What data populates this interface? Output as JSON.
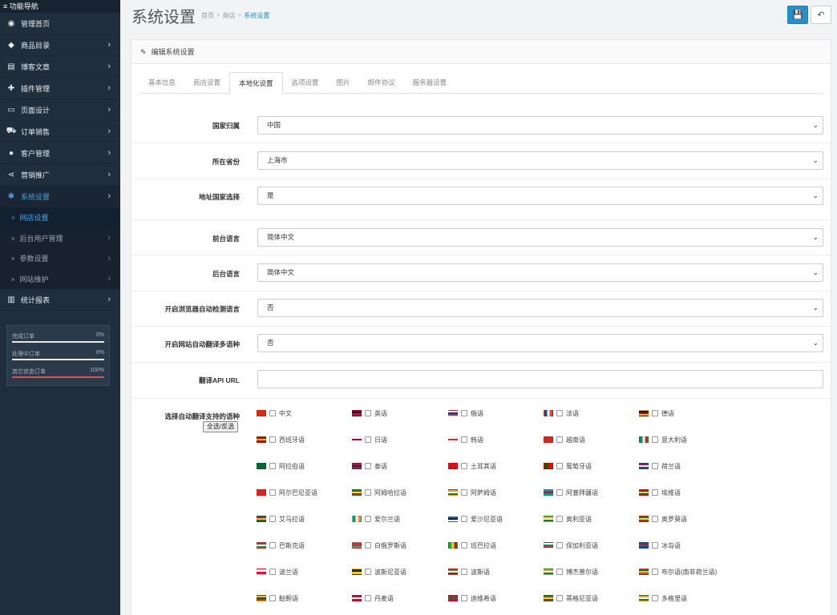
{
  "sidebar": {
    "title": "≡ 功能导航",
    "items": [
      {
        "label": "管理首页",
        "icon": "dashboard-icon",
        "glyph": "◉",
        "chevron": false
      },
      {
        "label": "商品目录",
        "icon": "tag-icon",
        "glyph": "◆",
        "chevron": true
      },
      {
        "label": "博客文章",
        "icon": "newspaper-icon",
        "glyph": "▤",
        "chevron": true
      },
      {
        "label": "插件管理",
        "icon": "puzzle-icon",
        "glyph": "✚",
        "chevron": true
      },
      {
        "label": "页面设计",
        "icon": "desktop-icon",
        "glyph": "▭",
        "chevron": true
      },
      {
        "label": "订单销售",
        "icon": "cart-icon",
        "glyph": "⛟",
        "chevron": true
      },
      {
        "label": "客户管理",
        "icon": "user-icon",
        "glyph": "●",
        "chevron": true
      },
      {
        "label": "营销推广",
        "icon": "share-icon",
        "glyph": "⋖",
        "chevron": true
      },
      {
        "label": "系统设置",
        "icon": "gear-icon",
        "glyph": "✱",
        "chevron": true
      }
    ],
    "sub_items": [
      {
        "label": "网店设置",
        "chevron": false
      },
      {
        "label": "后台用户管理",
        "chevron": true
      },
      {
        "label": "参数设置",
        "chevron": true
      },
      {
        "label": "网站维护",
        "chevron": true
      }
    ],
    "reports": {
      "label": "统计报表",
      "icon": "bar-chart-icon",
      "glyph": "▥"
    },
    "stats": [
      {
        "label": "完成订单",
        "value": "0%",
        "fraction": 0,
        "color": "#5cb85c"
      },
      {
        "label": "处理中订单",
        "value": "0%",
        "fraction": 0,
        "color": "#f0ad4e"
      },
      {
        "label": "其它状态订单",
        "value": "100%",
        "fraction": 1,
        "color": "#d9534f"
      }
    ]
  },
  "header": {
    "title": "系统设置",
    "breadcrumb": [
      "首页",
      "›",
      "商店",
      "›",
      "系统设置"
    ],
    "save_icon": "save-icon",
    "back_icon": "undo-icon"
  },
  "panel": {
    "title": "编辑系统设置",
    "tabs": [
      "基本信息",
      "商店设置",
      "本地化设置",
      "选项设置",
      "图片",
      "邮件协议",
      "服务器设置"
    ],
    "active_tab": "本地化设置"
  },
  "form": {
    "country_label": "国家归属",
    "country_value": "中国",
    "province_label": "所在省份",
    "province_value": "上海市",
    "address_label": "地址国家选择",
    "address_value": "是",
    "front_lang_label": "前台语言",
    "front_lang_value": "简体中文",
    "admin_lang_label": "后台语言",
    "admin_lang_value": "简体中文",
    "browser_detect_label": "开启浏览器自动检测语言",
    "browser_detect_value": "否",
    "auto_translate_label": "开启网站自动翻译多语种",
    "auto_translate_value": "否",
    "api_url_label": "翻译API URL",
    "api_url_value": "",
    "langs_label": "选择自动翻译支持的语种",
    "select_all_label": "全选/反选"
  },
  "languages": [
    {
      "name": "中文",
      "colors": [
        "#de2910",
        "#de2910"
      ]
    },
    {
      "name": "英语",
      "colors": [
        "#012169",
        "#c8102e"
      ]
    },
    {
      "name": "俄语",
      "colors": [
        "#ffffff",
        "#0039a6",
        "#d52b1e"
      ]
    },
    {
      "name": "法语",
      "colors": [
        "#0055a4",
        "#ffffff",
        "#ef4135"
      ],
      "vertical": true
    },
    {
      "name": "德语",
      "colors": [
        "#000000",
        "#dd0000",
        "#ffce00"
      ]
    },
    {
      "name": "西班牙语",
      "colors": [
        "#aa151b",
        "#f1bf00",
        "#aa151b"
      ]
    },
    {
      "name": "日语",
      "colors": [
        "#ffffff",
        "#bc002d",
        "#ffffff"
      ]
    },
    {
      "name": "韩语",
      "colors": [
        "#ffffff",
        "#cd2e3a",
        "#ffffff"
      ]
    },
    {
      "name": "越南语",
      "colors": [
        "#da251d",
        "#da251d"
      ]
    },
    {
      "name": "意大利语",
      "colors": [
        "#009246",
        "#ffffff",
        "#ce2b37"
      ],
      "vertical": true
    },
    {
      "name": "阿拉伯语",
      "colors": [
        "#006c35",
        "#006c35"
      ]
    },
    {
      "name": "泰语",
      "colors": [
        "#a51931",
        "#2d2a4a",
        "#a51931"
      ]
    },
    {
      "name": "土耳其语",
      "colors": [
        "#e30a17",
        "#e30a17"
      ]
    },
    {
      "name": "葡萄牙语",
      "colors": [
        "#006600",
        "#ff0000"
      ],
      "vertical": true
    },
    {
      "name": "荷兰语",
      "colors": [
        "#ae1c28",
        "#ffffff",
        "#21468b"
      ]
    },
    {
      "name": "阿尔巴尼亚语",
      "colors": [
        "#e41e20",
        "#e41e20"
      ]
    },
    {
      "name": "阿姆哈拉语",
      "colors": [
        "#078930",
        "#fcdd09",
        "#da121a"
      ]
    },
    {
      "name": "阿萨姆语",
      "colors": [
        "#ff9933",
        "#ffffff",
        "#138808"
      ]
    },
    {
      "name": "阿塞拜疆语",
      "colors": [
        "#0092bc",
        "#e4002b",
        "#00af66"
      ]
    },
    {
      "name": "埃维语",
      "colors": [
        "#ce1126",
        "#fcd116",
        "#006b3f"
      ]
    },
    {
      "name": "艾马拉语",
      "colors": [
        "#ce1126",
        "#fcd116",
        "#006b3f"
      ]
    },
    {
      "name": "爱尔兰语",
      "colors": [
        "#169b62",
        "#ffffff",
        "#ff883e"
      ],
      "vertical": true
    },
    {
      "name": "爱沙尼亚语",
      "colors": [
        "#0072ce",
        "#000000",
        "#ffffff"
      ]
    },
    {
      "name": "奥利亚语",
      "colors": [
        "#ff9933",
        "#ffffff",
        "#138808"
      ]
    },
    {
      "name": "奥罗莫语",
      "colors": [
        "#078930",
        "#fcdd09",
        "#da121a"
      ]
    },
    {
      "name": "巴斯克语",
      "colors": [
        "#d52b1e",
        "#ffffff",
        "#009b48"
      ]
    },
    {
      "name": "白俄罗斯语",
      "colors": [
        "#c8313e",
        "#c8313e",
        "#4aa657"
      ]
    },
    {
      "name": "班巴拉语",
      "colors": [
        "#14b53a",
        "#fcd116",
        "#ce1126"
      ],
      "vertical": true
    },
    {
      "name": "保加利亚语",
      "colors": [
        "#ffffff",
        "#00966e",
        "#d62612"
      ]
    },
    {
      "name": "冰岛语",
      "colors": [
        "#02529c",
        "#dc1e35",
        "#02529c"
      ]
    },
    {
      "name": "波兰语",
      "colors": [
        "#ffffff",
        "#dc143c"
      ]
    },
    {
      "name": "波斯尼亚语",
      "colors": [
        "#002395",
        "#fecb00"
      ]
    },
    {
      "name": "波斯语",
      "colors": [
        "#239f40",
        "#ffffff",
        "#da0000"
      ]
    },
    {
      "name": "博杰普尔语",
      "colors": [
        "#ff9933",
        "#ffffff",
        "#138808"
      ]
    },
    {
      "name": "布尔语(南非荷兰语)",
      "colors": [
        "#007a4d",
        "#ffb612",
        "#de3831"
      ]
    },
    {
      "name": "鞑靼语",
      "colors": [
        "#fdb913",
        "#006a44",
        "#c1272d"
      ]
    },
    {
      "name": "丹麦语",
      "colors": [
        "#c60c30",
        "#ffffff",
        "#c60c30"
      ]
    },
    {
      "name": "迪维希语",
      "colors": [
        "#d21034",
        "#007e3a",
        "#d21034"
      ]
    },
    {
      "name": "蒂格尼亚语",
      "colors": [
        "#078930",
        "#fcdd09",
        "#da121a"
      ]
    },
    {
      "name": "多格里语",
      "colors": [
        "#ff9933",
        "#ffffff",
        "#138808"
      ]
    }
  ]
}
